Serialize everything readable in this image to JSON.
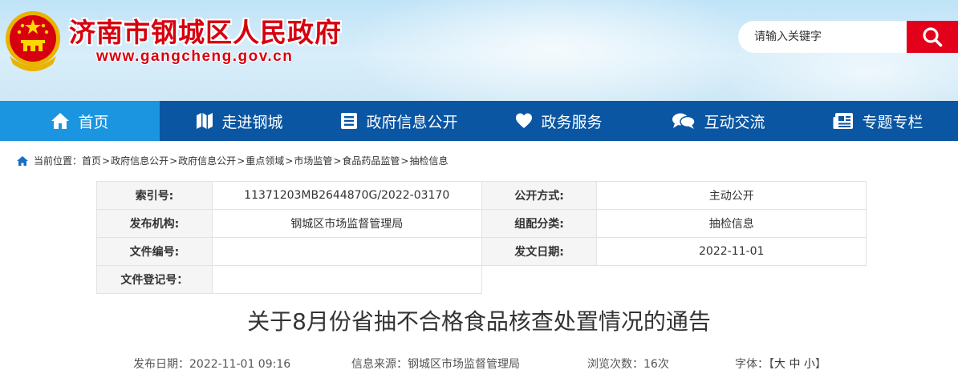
{
  "header": {
    "site_title": "济南市钢城区人民政府",
    "site_url": "www.gangcheng.gov.cn",
    "search_placeholder": "请输入关键字"
  },
  "colors": {
    "brand_red": "#d7000f",
    "nav_blue": "#0a56a2",
    "nav_active": "#1b95e0",
    "search_red": "#e2001a"
  },
  "nav": {
    "items": [
      {
        "label": "首页",
        "icon": "home-icon"
      },
      {
        "label": "走进钢城",
        "icon": "map-icon"
      },
      {
        "label": "政府信息公开",
        "icon": "list-icon"
      },
      {
        "label": "政务服务",
        "icon": "heart-icon"
      },
      {
        "label": "互动交流",
        "icon": "chat-icon"
      },
      {
        "label": "专题专栏",
        "icon": "newspaper-icon"
      }
    ]
  },
  "breadcrumb": {
    "prefix": "当前位置：",
    "items": [
      "首页",
      "政府信息公开",
      "政府信息公开",
      "重点领域",
      "市场监管",
      "食品药品监管",
      "抽检信息"
    ],
    "separator": ">"
  },
  "meta": {
    "index_label": "索引号:",
    "index_value": "11371203MB2644870G/2022-03170",
    "publish_mode_label": "公开方式:",
    "publish_mode_value": "主动公开",
    "org_label": "发布机构:",
    "org_value": "钢城区市场监督管理局",
    "category_label": "组配分类:",
    "category_value": "抽检信息",
    "doc_no_label": "文件编号:",
    "doc_no_value": "",
    "issue_date_label": "发文日期:",
    "issue_date_value": "2022-11-01",
    "reg_no_label": "文件登记号：",
    "reg_no_value": ""
  },
  "article": {
    "title": "关于8月份省抽不合格食品核查处置情况的通告",
    "publish_date": "发布日期：2022-11-01 09:16",
    "source": "信息来源：钢城区市场监督管理局",
    "views": "浏览次数：16次",
    "font_label": "字体：【",
    "font_large": "大",
    "font_medium": "中",
    "font_small": "小",
    "font_close": "】"
  }
}
